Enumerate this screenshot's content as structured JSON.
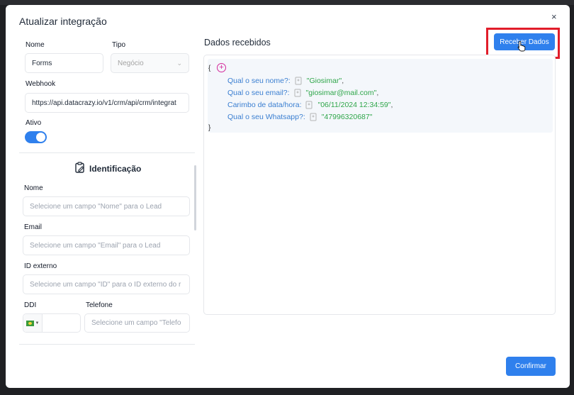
{
  "modal": {
    "title": "Atualizar integração",
    "close": "×"
  },
  "form": {
    "nome_label": "Nome",
    "nome_value": "Forms",
    "tipo_label": "Tipo",
    "tipo_value": "Negócio",
    "webhook_label": "Webhook",
    "webhook_value": "https://api.datacrazy.io/v1/crm/api/crm/integrat",
    "ativo_label": "Ativo",
    "ativo_on": true
  },
  "identificacao": {
    "title": "Identificação",
    "fields": [
      {
        "label": "Nome",
        "placeholder": "Selecione um campo \"Nome\" para o Lead"
      },
      {
        "label": "Email",
        "placeholder": "Selecione um campo \"Email\" para o Lead"
      },
      {
        "label": "ID externo",
        "placeholder": "Selecione um campo \"ID\" para o ID externo do r"
      }
    ],
    "ddi_label": "DDI",
    "telefone_label": "Telefone",
    "telefone_placeholder": "Selecione um campo \"Telefo"
  },
  "dados": {
    "title": "Dados recebidos",
    "button": "Receber Dados",
    "open_brace": "{",
    "close_brace": "}",
    "entries": [
      {
        "key": "Qual o seu nome?",
        "value": "\"Giosimar\""
      },
      {
        "key": "Qual o seu email?",
        "value": "\"giosimar@mail.com\""
      },
      {
        "key": "Carimbo de data/hora",
        "value": "\"06/11/2024 12:34:59\""
      },
      {
        "key": "Qual o seu Whatsapp?",
        "value": "\"47996320687\""
      }
    ]
  },
  "footer": {
    "confirm": "Confirmar"
  },
  "colors": {
    "accent": "#2f80ed",
    "highlight": "#e11d2a",
    "json_key": "#3b7fd1",
    "json_value": "#2fa64a"
  }
}
